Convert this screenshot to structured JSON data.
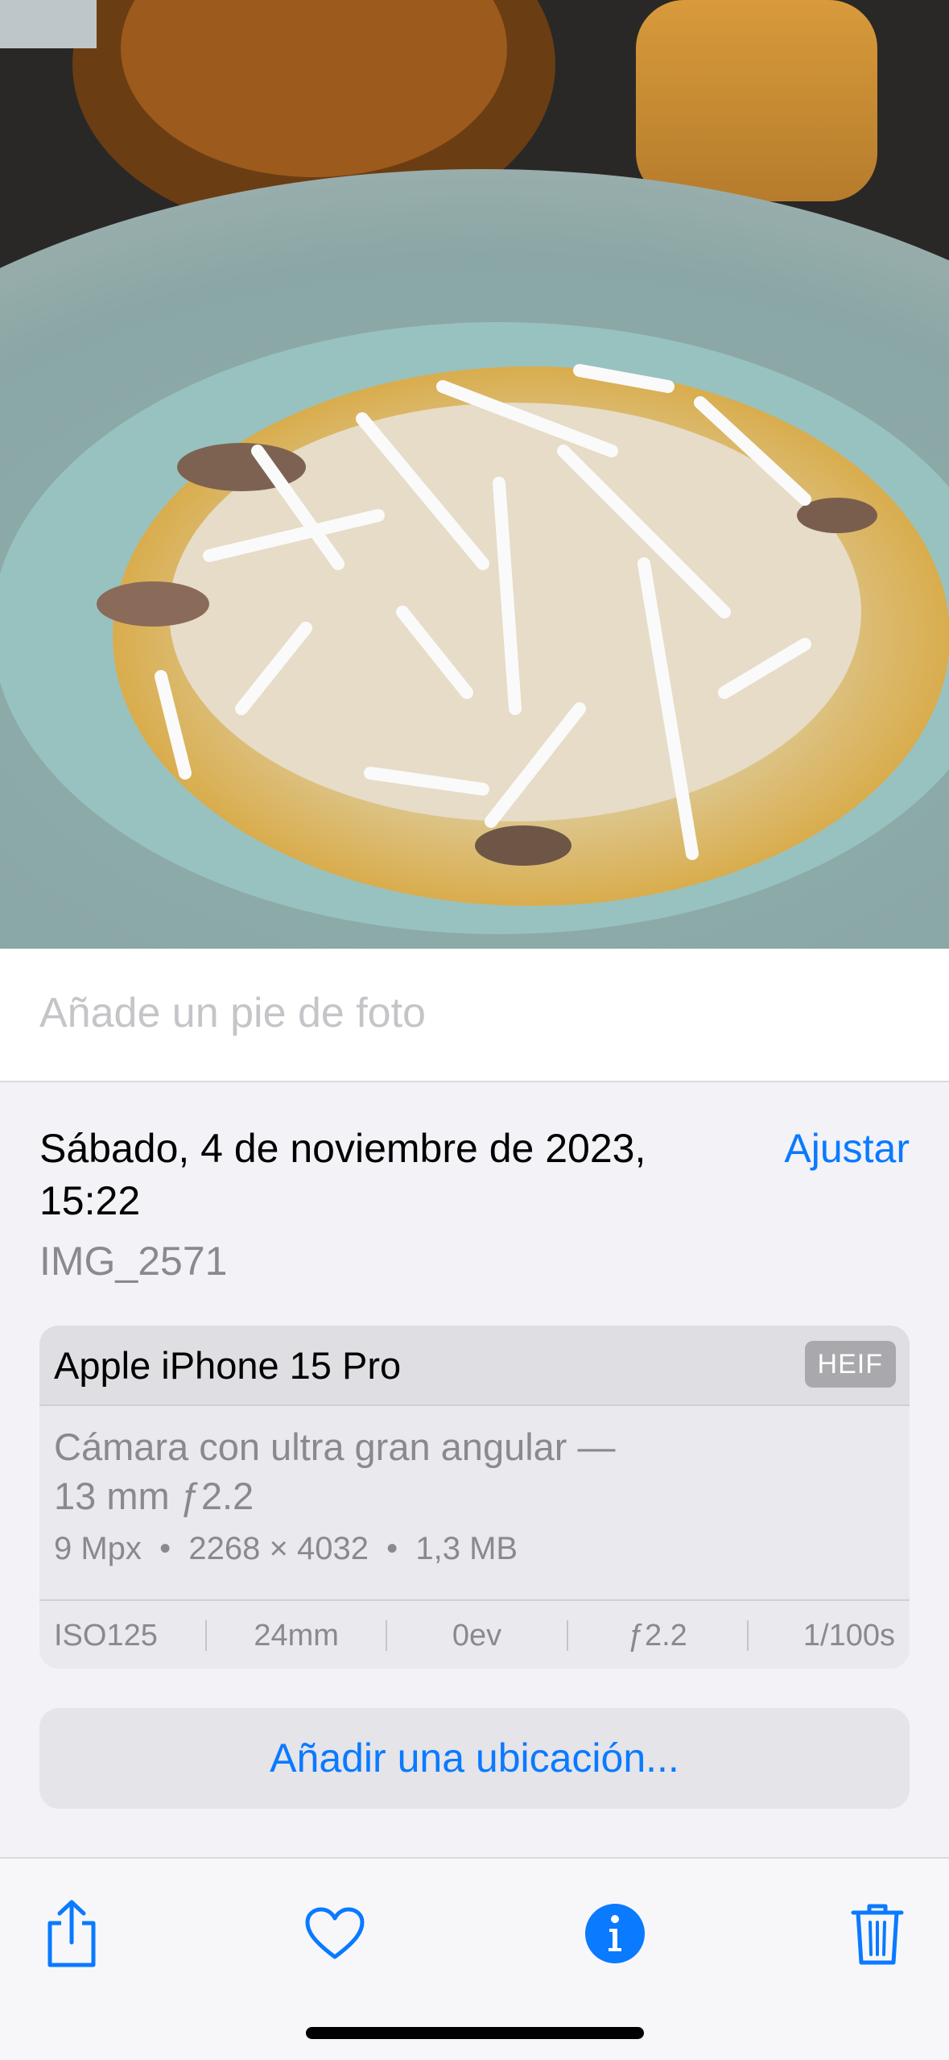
{
  "caption": {
    "placeholder": "Añade un pie de foto",
    "value": ""
  },
  "details": {
    "date": "Sábado, 4 de noviembre de 2023, 15:22",
    "adjust_label": "Ajustar",
    "filename": "IMG_2571"
  },
  "camera": {
    "device": "Apple iPhone 15 Pro",
    "format": "HEIF",
    "lens_line1": "Cámara con ultra gran angular —",
    "lens_line2": "13 mm ƒ2.2",
    "specs": "9 Mpx  •  2268 × 4032  •  1,3 MB",
    "exif": {
      "iso": "ISO125",
      "focal": "24mm",
      "exposure": "0ev",
      "aperture": "ƒ2.2",
      "shutter": "1/100s"
    }
  },
  "location": {
    "label": "Añadir una ubicación..."
  },
  "toolbar": {
    "icons": [
      "share-icon",
      "heart-icon",
      "info-icon",
      "trash-icon"
    ],
    "accent_color": "#0a7aff"
  }
}
